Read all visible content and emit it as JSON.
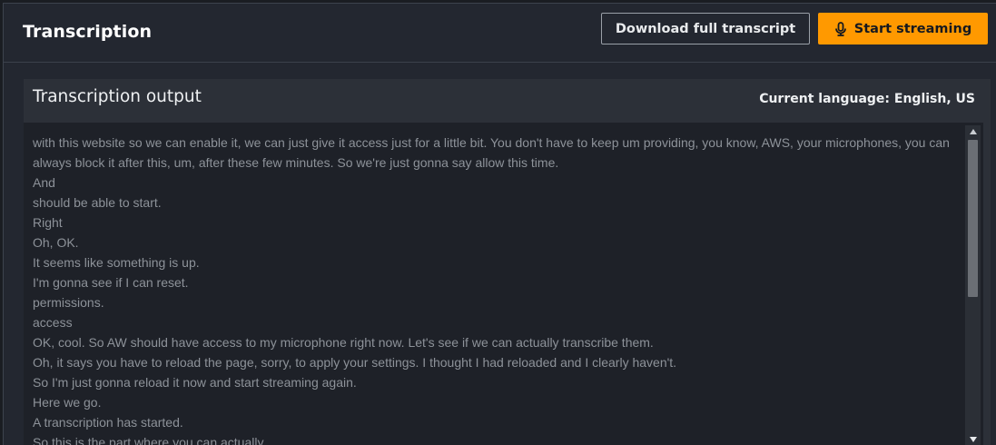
{
  "header": {
    "title": "Transcription",
    "download_label": "Download full transcript",
    "stream_label": "Start streaming",
    "stream_icon": "microphone-icon",
    "accent_color": "#ff9900"
  },
  "panel": {
    "title": "Transcription output",
    "language": "Current language: English, US"
  },
  "transcript": {
    "lines": [
      "with this website so we can enable it, we can just give it access just for a little bit. You don't have to keep um providing, you know, AWS, your microphones, you can always block it after this, um, after these few minutes. So we're just gonna say allow this time.",
      "And",
      "should be able to start.",
      "Right",
      "Oh, OK.",
      "It seems like something is up.",
      "I'm gonna see if I can reset.",
      "permissions.",
      "access",
      "OK, cool. So AW should have access to my microphone right now. Let's see if we can actually transcribe them.",
      "Oh, it says you have to reload the page, sorry, to apply your settings. I thought I had reloaded and I clearly haven't.",
      "So I'm just gonna reload it now and start streaming again.",
      "Here we go.",
      "A transcription has started.",
      "So this is the part where you can actually"
    ]
  }
}
